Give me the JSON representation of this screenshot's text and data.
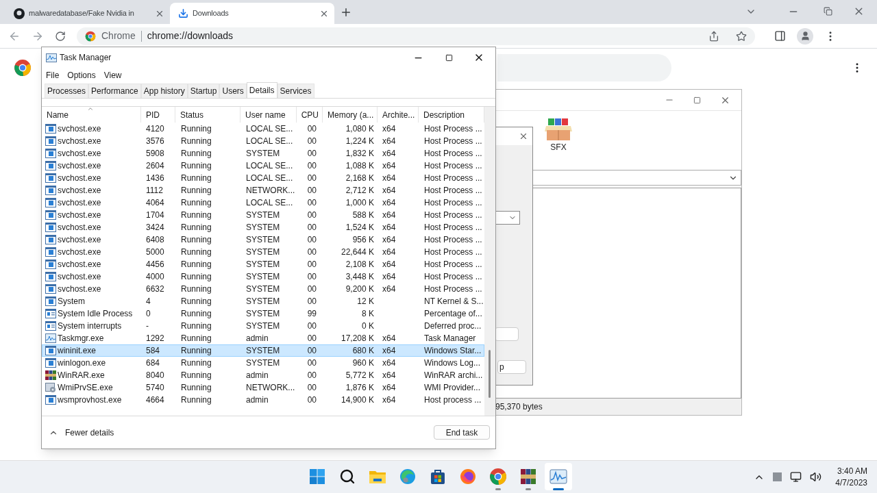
{
  "browser": {
    "tabs": [
      {
        "title": "malwaredatabase/Fake Nvidia in",
        "kind": "repo",
        "selected": false
      },
      {
        "title": "Downloads",
        "kind": "download",
        "selected": true
      }
    ],
    "omnibox": {
      "chip": "Chrome",
      "url": "chrome://downloads"
    }
  },
  "task_manager": {
    "title": "Task Manager",
    "menu": [
      "File",
      "Options",
      "View"
    ],
    "tabs": [
      {
        "label": "Processes",
        "selected": false
      },
      {
        "label": "Performance",
        "selected": false
      },
      {
        "label": "App history",
        "selected": false
      },
      {
        "label": "Startup",
        "selected": false
      },
      {
        "label": "Users",
        "selected": false
      },
      {
        "label": "Details",
        "selected": true
      },
      {
        "label": "Services",
        "selected": false
      }
    ],
    "columns": [
      "Name",
      "PID",
      "Status",
      "User name",
      "CPU",
      "Memory (a...",
      "Archite...",
      "Description"
    ],
    "rows": [
      {
        "kind": "service",
        "name": "svchost.exe",
        "pid": "4120",
        "status": "Running",
        "user": "LOCAL SE...",
        "cpu": "00",
        "memory": "1,080 K",
        "arch": "x64",
        "description": "Host Process ...",
        "selected": false
      },
      {
        "kind": "service",
        "name": "svchost.exe",
        "pid": "3576",
        "status": "Running",
        "user": "LOCAL SE...",
        "cpu": "00",
        "memory": "1,224 K",
        "arch": "x64",
        "description": "Host Process ...",
        "selected": false
      },
      {
        "kind": "service",
        "name": "svchost.exe",
        "pid": "5908",
        "status": "Running",
        "user": "SYSTEM",
        "cpu": "00",
        "memory": "1,832 K",
        "arch": "x64",
        "description": "Host Process ...",
        "selected": false
      },
      {
        "kind": "service",
        "name": "svchost.exe",
        "pid": "2604",
        "status": "Running",
        "user": "LOCAL SE...",
        "cpu": "00",
        "memory": "1,088 K",
        "arch": "x64",
        "description": "Host Process ...",
        "selected": false
      },
      {
        "kind": "service",
        "name": "svchost.exe",
        "pid": "1436",
        "status": "Running",
        "user": "LOCAL SE...",
        "cpu": "00",
        "memory": "2,168 K",
        "arch": "x64",
        "description": "Host Process ...",
        "selected": false
      },
      {
        "kind": "service",
        "name": "svchost.exe",
        "pid": "1112",
        "status": "Running",
        "user": "NETWORK...",
        "cpu": "00",
        "memory": "2,712 K",
        "arch": "x64",
        "description": "Host Process ...",
        "selected": false
      },
      {
        "kind": "service",
        "name": "svchost.exe",
        "pid": "4064",
        "status": "Running",
        "user": "LOCAL SE...",
        "cpu": "00",
        "memory": "1,000 K",
        "arch": "x64",
        "description": "Host Process ...",
        "selected": false
      },
      {
        "kind": "service",
        "name": "svchost.exe",
        "pid": "1704",
        "status": "Running",
        "user": "SYSTEM",
        "cpu": "00",
        "memory": "588 K",
        "arch": "x64",
        "description": "Host Process ...",
        "selected": false
      },
      {
        "kind": "service",
        "name": "svchost.exe",
        "pid": "3424",
        "status": "Running",
        "user": "SYSTEM",
        "cpu": "00",
        "memory": "1,524 K",
        "arch": "x64",
        "description": "Host Process ...",
        "selected": false
      },
      {
        "kind": "service",
        "name": "svchost.exe",
        "pid": "6408",
        "status": "Running",
        "user": "SYSTEM",
        "cpu": "00",
        "memory": "956 K",
        "arch": "x64",
        "description": "Host Process ...",
        "selected": false
      },
      {
        "kind": "service",
        "name": "svchost.exe",
        "pid": "5000",
        "status": "Running",
        "user": "SYSTEM",
        "cpu": "00",
        "memory": "22,644 K",
        "arch": "x64",
        "description": "Host Process ...",
        "selected": false
      },
      {
        "kind": "service",
        "name": "svchost.exe",
        "pid": "4456",
        "status": "Running",
        "user": "SYSTEM",
        "cpu": "00",
        "memory": "2,108 K",
        "arch": "x64",
        "description": "Host Process ...",
        "selected": false
      },
      {
        "kind": "service",
        "name": "svchost.exe",
        "pid": "4000",
        "status": "Running",
        "user": "SYSTEM",
        "cpu": "00",
        "memory": "3,448 K",
        "arch": "x64",
        "description": "Host Process ...",
        "selected": false
      },
      {
        "kind": "service",
        "name": "svchost.exe",
        "pid": "6632",
        "status": "Running",
        "user": "SYSTEM",
        "cpu": "00",
        "memory": "9,200 K",
        "arch": "x64",
        "description": "Host Process ...",
        "selected": false
      },
      {
        "kind": "service",
        "name": "System",
        "pid": "4",
        "status": "Running",
        "user": "SYSTEM",
        "cpu": "00",
        "memory": "12 K",
        "description": "NT Kernel & S...",
        "selected": false
      },
      {
        "kind": "system",
        "name": "System Idle Process",
        "pid": "0",
        "status": "Running",
        "user": "SYSTEM",
        "cpu": "99",
        "memory": "8 K",
        "description": "Percentage of...",
        "selected": false
      },
      {
        "kind": "system",
        "name": "System interrupts",
        "pid": "-",
        "status": "Running",
        "user": "SYSTEM",
        "cpu": "00",
        "memory": "0 K",
        "description": "Deferred proc...",
        "selected": false
      },
      {
        "kind": "monitor",
        "name": "Taskmgr.exe",
        "pid": "1292",
        "status": "Running",
        "user": "admin",
        "cpu": "00",
        "memory": "17,208 K",
        "arch": "x64",
        "description": "Task Manager",
        "selected": false
      },
      {
        "kind": "service",
        "name": "wininit.exe",
        "pid": "584",
        "status": "Running",
        "user": "SYSTEM",
        "cpu": "00",
        "memory": "680 K",
        "arch": "x64",
        "description": "Windows Star...",
        "selected": true
      },
      {
        "kind": "service",
        "name": "winlogon.exe",
        "pid": "684",
        "status": "Running",
        "user": "SYSTEM",
        "cpu": "00",
        "memory": "960 K",
        "arch": "x64",
        "description": "Windows Log...",
        "selected": false
      },
      {
        "kind": "archive",
        "name": "WinRAR.exe",
        "pid": "8040",
        "status": "Running",
        "user": "admin",
        "cpu": "00",
        "memory": "5,772 K",
        "arch": "x64",
        "description": "WinRAR archi...",
        "selected": false
      },
      {
        "kind": "gear",
        "name": "WmiPrvSE.exe",
        "pid": "5740",
        "status": "Running",
        "user": "NETWORK...",
        "cpu": "00",
        "memory": "1,876 K",
        "arch": "x64",
        "description": "WMI Provider...",
        "selected": false
      },
      {
        "kind": "service",
        "name": "wsmprovhost.exe",
        "pid": "4664",
        "status": "Running",
        "user": "admin",
        "cpu": "00",
        "memory": "14,900 K",
        "arch": "x64",
        "description": "Host process ...",
        "selected": false
      }
    ],
    "footer": {
      "toggle": "Fewer details",
      "button": "End task"
    }
  },
  "archiver": {
    "toolbar": [
      {
        "label": "SFX"
      }
    ],
    "dialog_button": "p",
    "status": "95,370 bytes"
  },
  "taskbar": {
    "apps": [
      {
        "kind": "start",
        "running": false,
        "active": false
      },
      {
        "kind": "search",
        "running": false,
        "active": false
      },
      {
        "kind": "folder",
        "running": false,
        "active": false
      },
      {
        "kind": "edge",
        "running": false,
        "active": false
      },
      {
        "kind": "store",
        "running": false,
        "active": false
      },
      {
        "kind": "firefox",
        "running": false,
        "active": false
      },
      {
        "kind": "chrome",
        "running": true,
        "active": false
      },
      {
        "kind": "archive",
        "running": true,
        "active": false
      },
      {
        "kind": "monitor",
        "running": true,
        "active": true
      }
    ],
    "time": "3:40 AM",
    "date": "4/7/2023"
  }
}
